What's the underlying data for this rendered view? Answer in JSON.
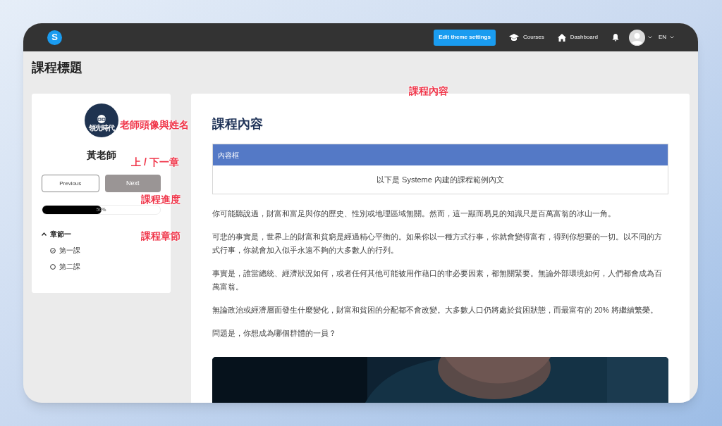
{
  "navbar": {
    "logo": "S",
    "theme_button": "Edit theme settings",
    "links": [
      {
        "kind": "courses",
        "label": "Courses"
      },
      {
        "kind": "dashboard",
        "label": "Dashboard"
      }
    ],
    "language": "EN"
  },
  "page_title": "課程標題",
  "sidebar": {
    "avatar_text": "領先時代",
    "teacher_name": "黃老師",
    "previous_button": {
      "label": "Previous",
      "disabled": false
    },
    "next_button": {
      "label": "Next",
      "disabled": true
    },
    "progress": {
      "level": 0.5,
      "label": "50%"
    },
    "chapters": [
      {
        "title": "章節一",
        "expanded": true,
        "lessons": [
          {
            "title": "第一課",
            "completed": true
          },
          {
            "title": "第二課",
            "completed": false
          }
        ]
      }
    ]
  },
  "content": {
    "heading": "課程內容",
    "box": {
      "title": "內容框",
      "text": "以下是 Systeme 內建的課程範例內文"
    },
    "paragraphs": [
      "你可能聽說過，財富和富足與你的歷史、性別或地理區域無關。然而，這一顯而易見的知識只是百萬富翁的冰山一角。",
      "可悲的事實是，世界上的財富和貧窮是經過精心平衡的。如果你以一種方式行事，你就會變得富有，得到你想要的一切。以不同的方式行事，你就會加入似乎永遠不夠的大多數人的行列。",
      "事實是，誰當總統、經濟狀況如何，或者任何其他可能被用作藉口的非必要因素，都無關緊要。無論外部環境如何，人們都會成為百萬富翁。",
      "無論政治或經濟層面發生什麼變化，財富和貧困的分配都不會改變。大多數人口仍將處於貧困狀態，而最富有的 20% 將繼續繁榮。",
      "問題是，你想成為哪個群體的一員？"
    ]
  },
  "annotations": [
    "課程內容",
    "老師頭像與姓名",
    "上 / 下一章",
    "課程進度",
    "課程章節"
  ]
}
